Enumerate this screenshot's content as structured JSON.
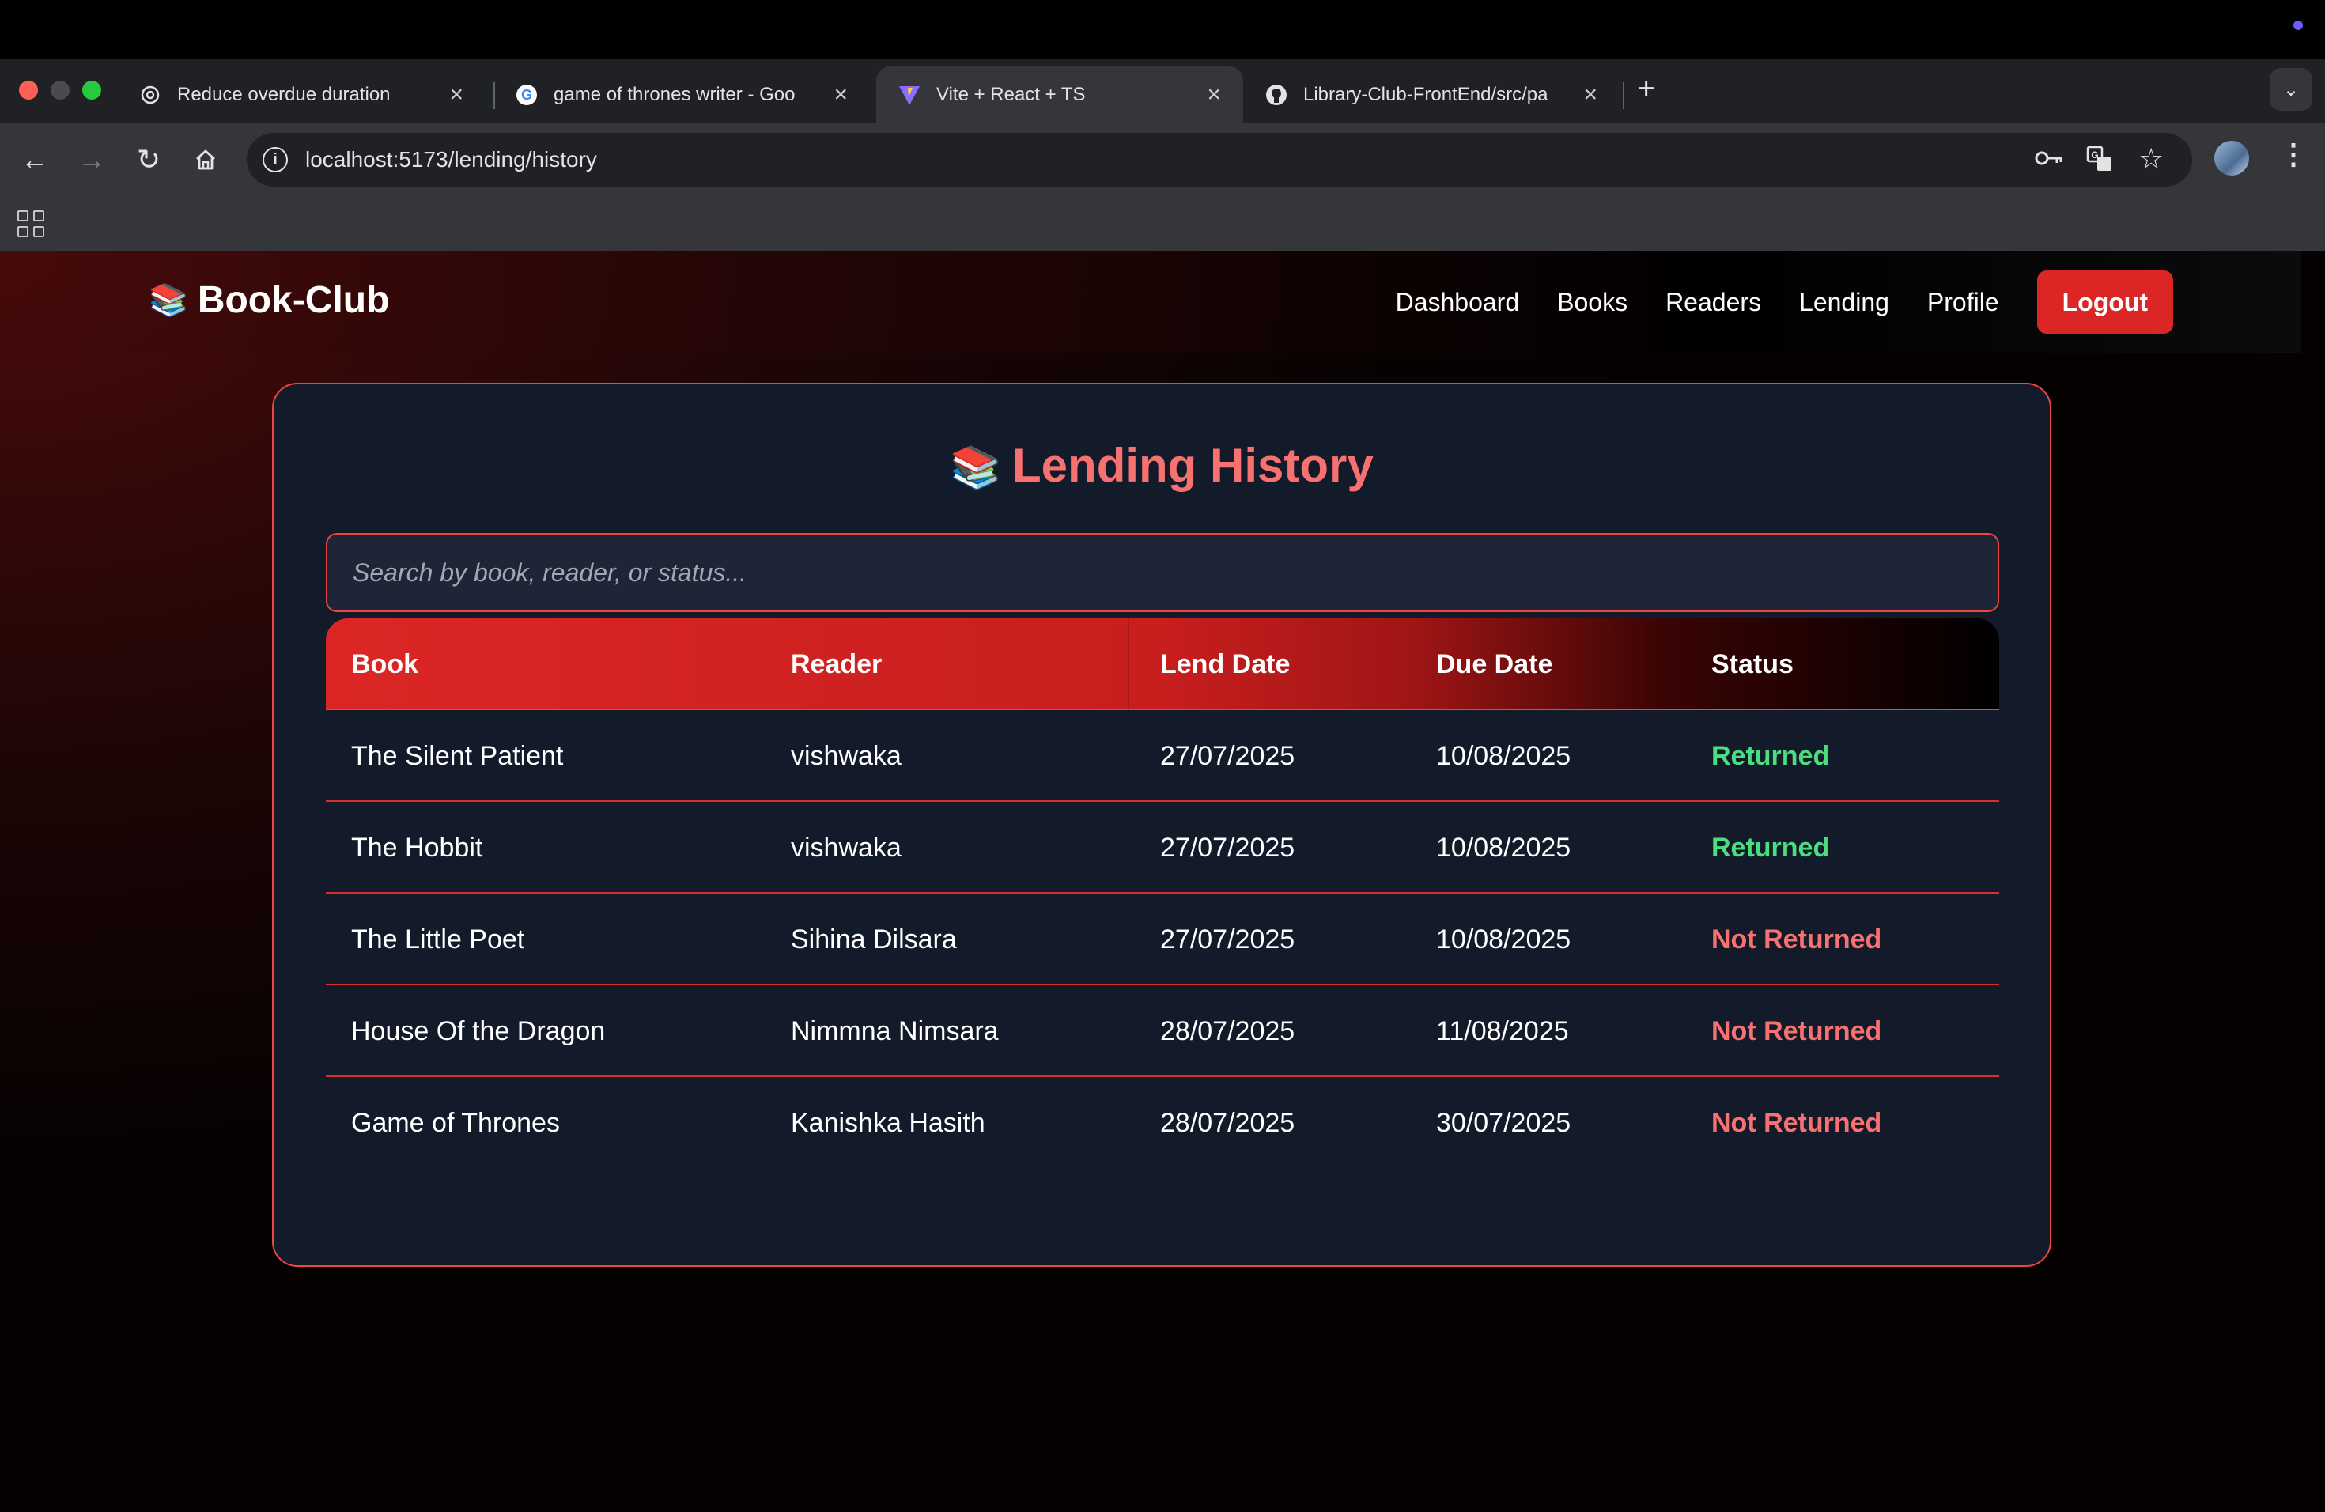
{
  "browser": {
    "tabs": [
      {
        "title": "Reduce overdue duration",
        "favicon": "openai-icon"
      },
      {
        "title": "game of thrones writer - Goo",
        "favicon": "google-icon"
      },
      {
        "title": "Vite + React + TS",
        "favicon": "vite-icon",
        "active": true
      },
      {
        "title": "Library-Club-FrontEnd/src/pa",
        "favicon": "github-icon"
      }
    ],
    "url": "localhost:5173/lending/history"
  },
  "nav": {
    "brand": "Book-Club",
    "brand_emoji": "📚",
    "links": [
      "Dashboard",
      "Books",
      "Readers",
      "Lending",
      "Profile"
    ],
    "logout": "Logout"
  },
  "main": {
    "title": "Lending History",
    "title_emoji": "📚",
    "search_placeholder": "Search by book, reader, or status...",
    "columns": [
      "Book",
      "Reader",
      "Lend Date",
      "Due Date",
      "Status"
    ],
    "rows": [
      {
        "book": "The Silent Patient",
        "reader": "vishwaka",
        "lend_date": "27/07/2025",
        "due_date": "10/08/2025",
        "status": "Returned"
      },
      {
        "book": "The Hobbit",
        "reader": "vishwaka",
        "lend_date": "27/07/2025",
        "due_date": "10/08/2025",
        "status": "Returned"
      },
      {
        "book": "The Little Poet",
        "reader": "Sihina Dilsara",
        "lend_date": "27/07/2025",
        "due_date": "10/08/2025",
        "status": "Not Returned"
      },
      {
        "book": "House Of the Dragon",
        "reader": "Nimmna Nimsara",
        "lend_date": "28/07/2025",
        "due_date": "11/08/2025",
        "status": "Not Returned"
      },
      {
        "book": "Game of Thrones",
        "reader": "Kanishka Hasith",
        "lend_date": "28/07/2025",
        "due_date": "30/07/2025",
        "status": "Not Returned"
      }
    ]
  },
  "colors": {
    "accent": "#dc2626",
    "returned": "#4ade80",
    "not_returned": "#f87171",
    "card_bg": "#131a2a"
  }
}
